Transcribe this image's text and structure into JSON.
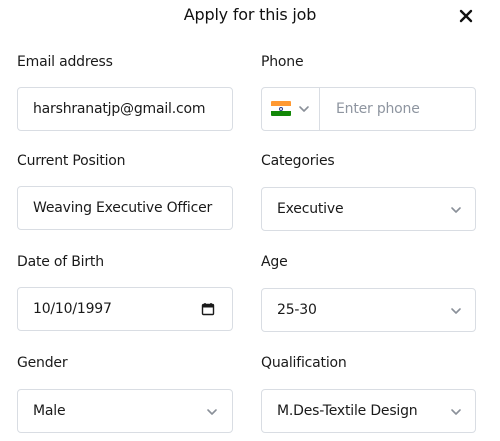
{
  "dialog": {
    "title": "Apply for this job",
    "close_icon": "close-icon"
  },
  "form": {
    "email": {
      "label": "Email address",
      "value": "harshranatjp@gmail.com"
    },
    "phone": {
      "label": "Phone",
      "placeholder": "Enter phone",
      "country_flag": "india-flag-icon"
    },
    "current_position": {
      "label": "Current Position",
      "value": "Weaving Executive Officer"
    },
    "categories": {
      "label": "Categories",
      "selected": "Executive"
    },
    "date_of_birth": {
      "label": "Date of Birth",
      "value": "10/10/1997",
      "icon": "calendar-icon"
    },
    "age": {
      "label": "Age",
      "selected": "25-30"
    },
    "gender": {
      "label": "Gender",
      "selected": "Male"
    },
    "qualification": {
      "label": "Qualification",
      "selected": "M.Des-Textile Design"
    }
  },
  "colors": {
    "border": "#d9dde3",
    "text": "#1a1a1a",
    "placeholder": "#8e95a0",
    "chevron": "#8a9099"
  }
}
